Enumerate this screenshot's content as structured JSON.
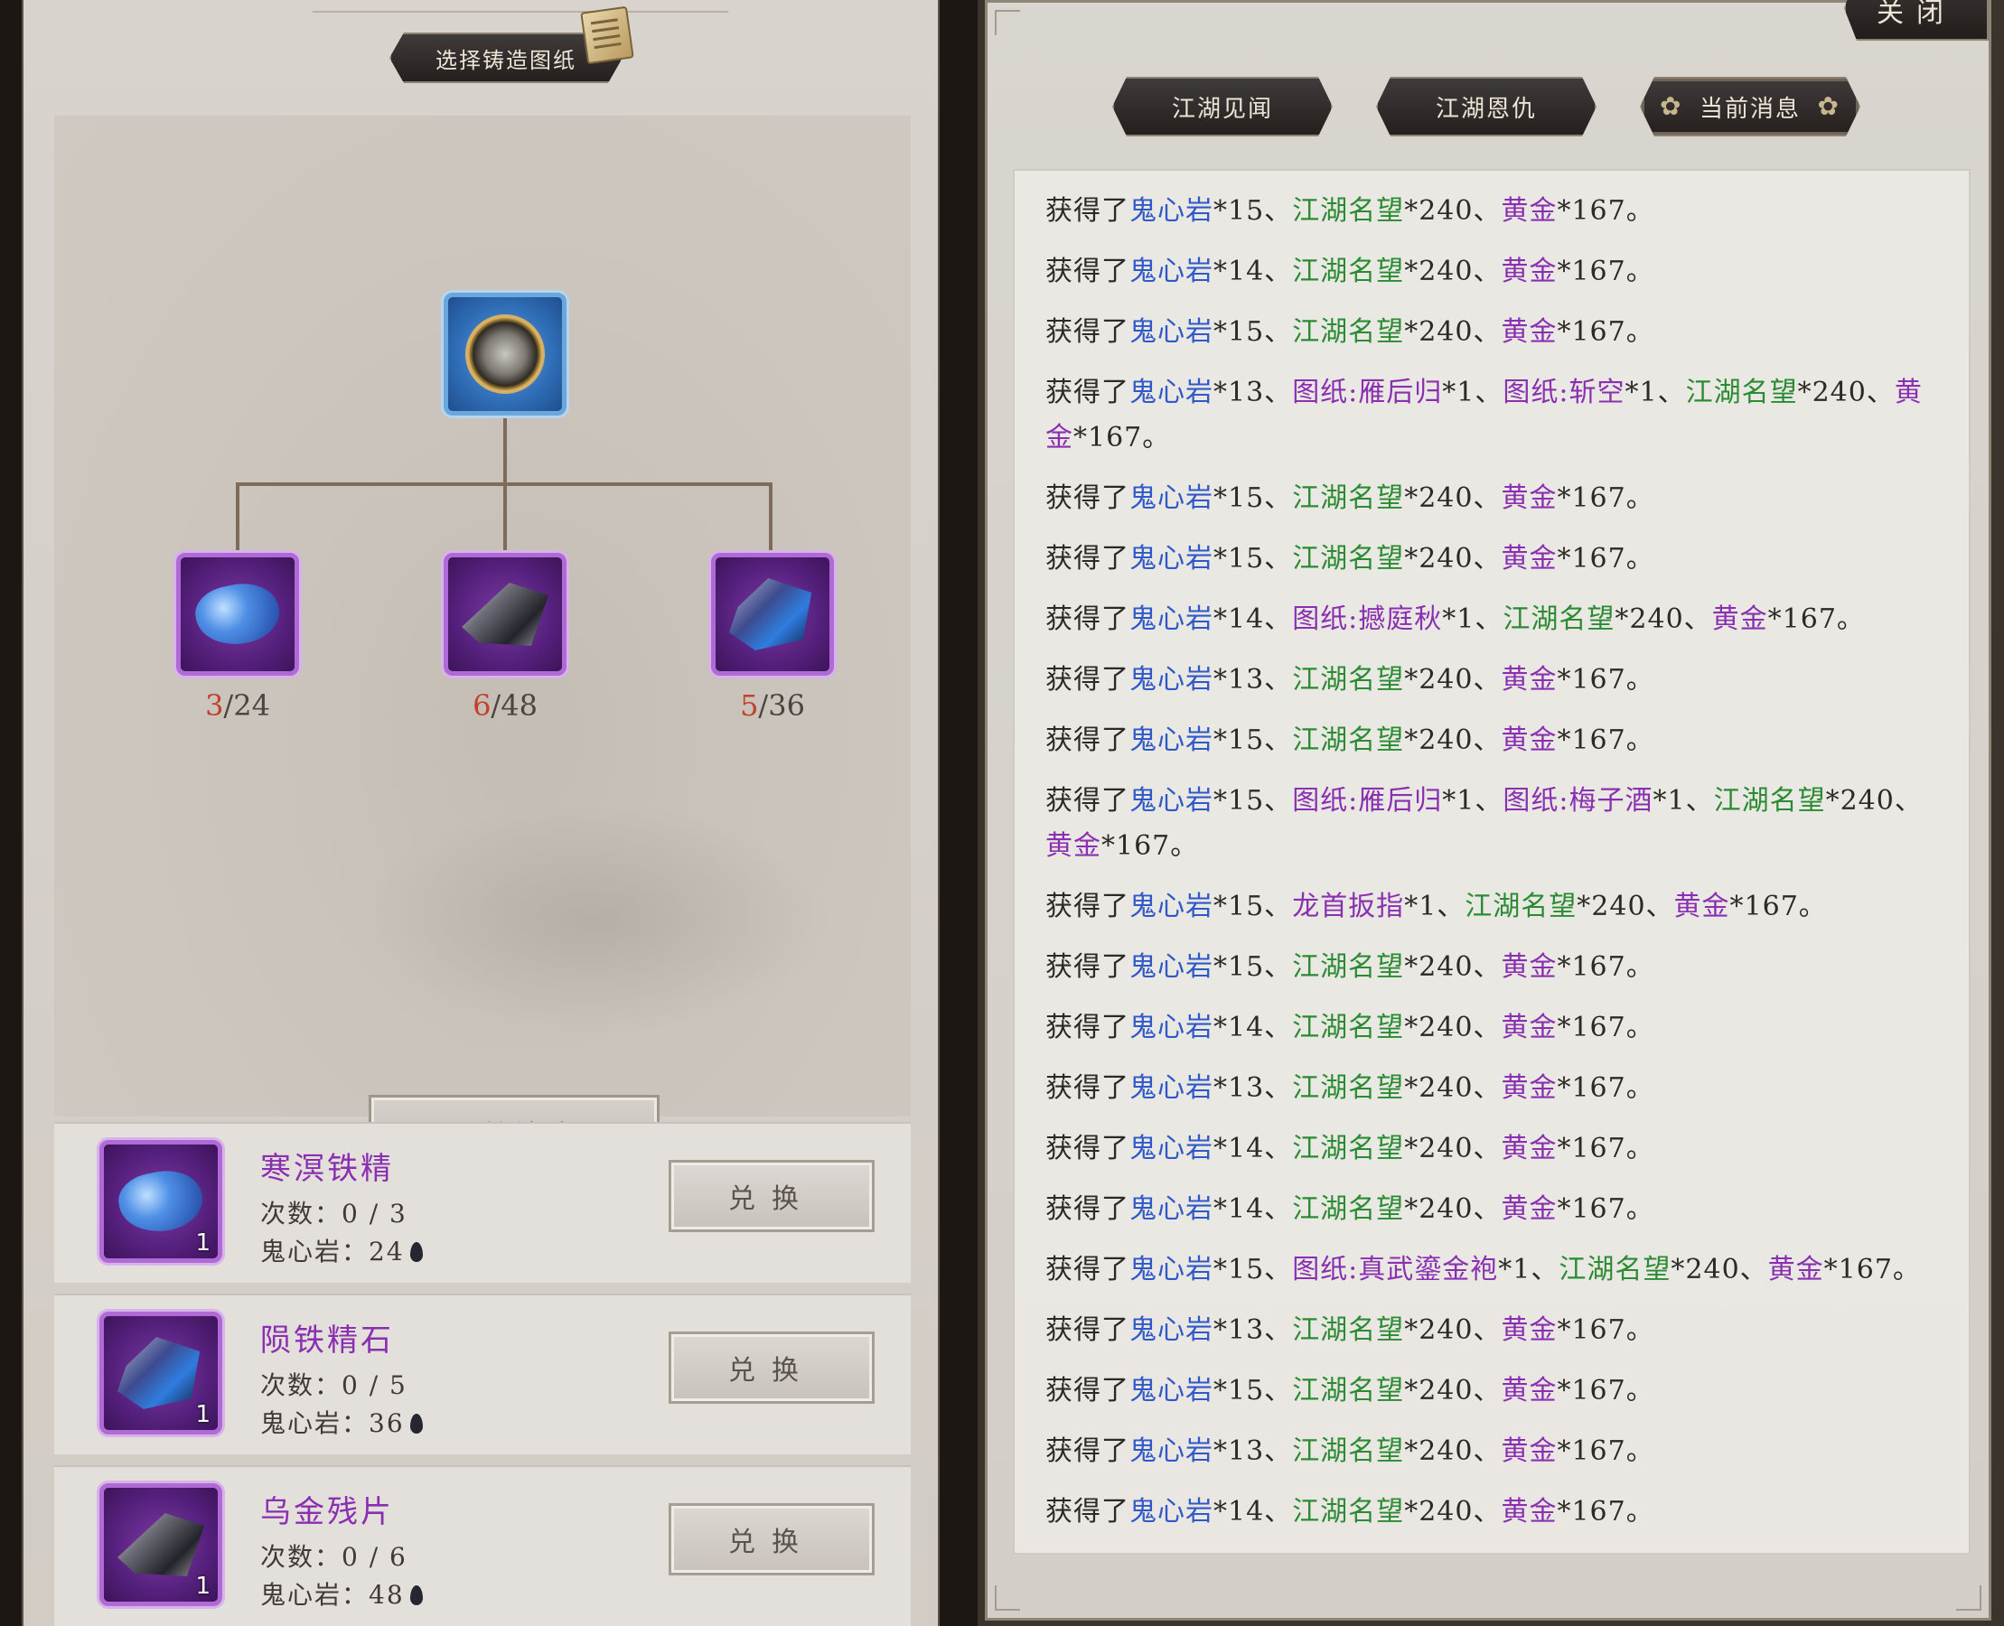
{
  "left": {
    "blueprint_button": "选择铸造图纸",
    "tree": {
      "top_item": "ring-icon",
      "materials": [
        {
          "icon": "blue-gem-icon",
          "have": "3",
          "need": "/24"
        },
        {
          "icon": "dark-shard-icon",
          "have": "6",
          "need": "/48"
        },
        {
          "icon": "meteor-crystal-icon",
          "have": "5",
          "need": "/36"
        }
      ]
    },
    "forge_button": "开始铸造",
    "exchange": [
      {
        "name": "寒溟铁精",
        "count_label": "次数：0 / 3",
        "cost_label": "鬼心岩：24",
        "stack": "1",
        "button": "兑换"
      },
      {
        "name": "陨铁精石",
        "count_label": "次数：0 / 5",
        "cost_label": "鬼心岩：36",
        "stack": "1",
        "button": "兑换"
      },
      {
        "name": "乌金残片",
        "count_label": "次数：0 / 6",
        "cost_label": "鬼心岩：48",
        "stack": "1",
        "button": "兑换"
      }
    ]
  },
  "right": {
    "close_button": "关闭",
    "tabs": [
      "江湖见闻",
      "江湖恩仇",
      "当前消息"
    ],
    "active_tab": "当前消息",
    "colors": {
      "item_blue": "#2f58c9",
      "fame_green": "#2a8b33",
      "gold_purple": "#8a2fb1"
    },
    "log": [
      [
        [
          "t",
          "获得了"
        ],
        [
          "b",
          "鬼心岩"
        ],
        [
          "t",
          "*15、"
        ],
        [
          "g",
          "江湖名望"
        ],
        [
          "t",
          "*240、"
        ],
        [
          "p",
          "黄金"
        ],
        [
          "t",
          "*167。"
        ]
      ],
      [
        [
          "t",
          "获得了"
        ],
        [
          "b",
          "鬼心岩"
        ],
        [
          "t",
          "*14、"
        ],
        [
          "g",
          "江湖名望"
        ],
        [
          "t",
          "*240、"
        ],
        [
          "p",
          "黄金"
        ],
        [
          "t",
          "*167。"
        ]
      ],
      [
        [
          "t",
          "获得了"
        ],
        [
          "b",
          "鬼心岩"
        ],
        [
          "t",
          "*15、"
        ],
        [
          "g",
          "江湖名望"
        ],
        [
          "t",
          "*240、"
        ],
        [
          "p",
          "黄金"
        ],
        [
          "t",
          "*167。"
        ]
      ],
      [
        [
          "t",
          "获得了"
        ],
        [
          "b",
          "鬼心岩"
        ],
        [
          "t",
          "*13、"
        ],
        [
          "p",
          "图纸:雁后归"
        ],
        [
          "t",
          "*1、"
        ],
        [
          "p",
          "图纸:斩空"
        ],
        [
          "t",
          "*1、"
        ],
        [
          "g",
          "江湖名望"
        ],
        [
          "t",
          "*240、"
        ],
        [
          "p",
          "黄金"
        ],
        [
          "t",
          "*167。"
        ]
      ],
      [
        [
          "t",
          "获得了"
        ],
        [
          "b",
          "鬼心岩"
        ],
        [
          "t",
          "*15、"
        ],
        [
          "g",
          "江湖名望"
        ],
        [
          "t",
          "*240、"
        ],
        [
          "p",
          "黄金"
        ],
        [
          "t",
          "*167。"
        ]
      ],
      [
        [
          "t",
          "获得了"
        ],
        [
          "b",
          "鬼心岩"
        ],
        [
          "t",
          "*15、"
        ],
        [
          "g",
          "江湖名望"
        ],
        [
          "t",
          "*240、"
        ],
        [
          "p",
          "黄金"
        ],
        [
          "t",
          "*167。"
        ]
      ],
      [
        [
          "t",
          "获得了"
        ],
        [
          "b",
          "鬼心岩"
        ],
        [
          "t",
          "*14、"
        ],
        [
          "p",
          "图纸:撼庭秋"
        ],
        [
          "t",
          "*1、"
        ],
        [
          "g",
          "江湖名望"
        ],
        [
          "t",
          "*240、"
        ],
        [
          "p",
          "黄金"
        ],
        [
          "t",
          "*167。"
        ]
      ],
      [
        [
          "t",
          "获得了"
        ],
        [
          "b",
          "鬼心岩"
        ],
        [
          "t",
          "*13、"
        ],
        [
          "g",
          "江湖名望"
        ],
        [
          "t",
          "*240、"
        ],
        [
          "p",
          "黄金"
        ],
        [
          "t",
          "*167。"
        ]
      ],
      [
        [
          "t",
          "获得了"
        ],
        [
          "b",
          "鬼心岩"
        ],
        [
          "t",
          "*15、"
        ],
        [
          "g",
          "江湖名望"
        ],
        [
          "t",
          "*240、"
        ],
        [
          "p",
          "黄金"
        ],
        [
          "t",
          "*167。"
        ]
      ],
      [
        [
          "t",
          "获得了"
        ],
        [
          "b",
          "鬼心岩"
        ],
        [
          "t",
          "*15、"
        ],
        [
          "p",
          "图纸:雁后归"
        ],
        [
          "t",
          "*1、"
        ],
        [
          "p",
          "图纸:梅子酒"
        ],
        [
          "t",
          "*1、"
        ],
        [
          "g",
          "江湖名望"
        ],
        [
          "t",
          "*240、"
        ],
        [
          "p",
          "黄金"
        ],
        [
          "t",
          "*167。"
        ]
      ],
      [
        [
          "t",
          "获得了"
        ],
        [
          "b",
          "鬼心岩"
        ],
        [
          "t",
          "*15、"
        ],
        [
          "p",
          "龙首扳指"
        ],
        [
          "t",
          "*1、"
        ],
        [
          "g",
          "江湖名望"
        ],
        [
          "t",
          "*240、"
        ],
        [
          "p",
          "黄金"
        ],
        [
          "t",
          "*167。"
        ]
      ],
      [
        [
          "t",
          "获得了"
        ],
        [
          "b",
          "鬼心岩"
        ],
        [
          "t",
          "*15、"
        ],
        [
          "g",
          "江湖名望"
        ],
        [
          "t",
          "*240、"
        ],
        [
          "p",
          "黄金"
        ],
        [
          "t",
          "*167。"
        ]
      ],
      [
        [
          "t",
          "获得了"
        ],
        [
          "b",
          "鬼心岩"
        ],
        [
          "t",
          "*14、"
        ],
        [
          "g",
          "江湖名望"
        ],
        [
          "t",
          "*240、"
        ],
        [
          "p",
          "黄金"
        ],
        [
          "t",
          "*167。"
        ]
      ],
      [
        [
          "t",
          "获得了"
        ],
        [
          "b",
          "鬼心岩"
        ],
        [
          "t",
          "*13、"
        ],
        [
          "g",
          "江湖名望"
        ],
        [
          "t",
          "*240、"
        ],
        [
          "p",
          "黄金"
        ],
        [
          "t",
          "*167。"
        ]
      ],
      [
        [
          "t",
          "获得了"
        ],
        [
          "b",
          "鬼心岩"
        ],
        [
          "t",
          "*14、"
        ],
        [
          "g",
          "江湖名望"
        ],
        [
          "t",
          "*240、"
        ],
        [
          "p",
          "黄金"
        ],
        [
          "t",
          "*167。"
        ]
      ],
      [
        [
          "t",
          "获得了"
        ],
        [
          "b",
          "鬼心岩"
        ],
        [
          "t",
          "*14、"
        ],
        [
          "g",
          "江湖名望"
        ],
        [
          "t",
          "*240、"
        ],
        [
          "p",
          "黄金"
        ],
        [
          "t",
          "*167。"
        ]
      ],
      [
        [
          "t",
          "获得了"
        ],
        [
          "b",
          "鬼心岩"
        ],
        [
          "t",
          "*15、"
        ],
        [
          "p",
          "图纸:真武鎏金袍"
        ],
        [
          "t",
          "*1、"
        ],
        [
          "g",
          "江湖名望"
        ],
        [
          "t",
          "*240、"
        ],
        [
          "p",
          "黄金"
        ],
        [
          "t",
          "*167。"
        ]
      ],
      [
        [
          "t",
          "获得了"
        ],
        [
          "b",
          "鬼心岩"
        ],
        [
          "t",
          "*13、"
        ],
        [
          "g",
          "江湖名望"
        ],
        [
          "t",
          "*240、"
        ],
        [
          "p",
          "黄金"
        ],
        [
          "t",
          "*167。"
        ]
      ],
      [
        [
          "t",
          "获得了"
        ],
        [
          "b",
          "鬼心岩"
        ],
        [
          "t",
          "*15、"
        ],
        [
          "g",
          "江湖名望"
        ],
        [
          "t",
          "*240、"
        ],
        [
          "p",
          "黄金"
        ],
        [
          "t",
          "*167。"
        ]
      ],
      [
        [
          "t",
          "获得了"
        ],
        [
          "b",
          "鬼心岩"
        ],
        [
          "t",
          "*13、"
        ],
        [
          "g",
          "江湖名望"
        ],
        [
          "t",
          "*240、"
        ],
        [
          "p",
          "黄金"
        ],
        [
          "t",
          "*167。"
        ]
      ],
      [
        [
          "t",
          "获得了"
        ],
        [
          "b",
          "鬼心岩"
        ],
        [
          "t",
          "*14、"
        ],
        [
          "g",
          "江湖名望"
        ],
        [
          "t",
          "*240、"
        ],
        [
          "p",
          "黄金"
        ],
        [
          "t",
          "*167。"
        ]
      ]
    ]
  }
}
